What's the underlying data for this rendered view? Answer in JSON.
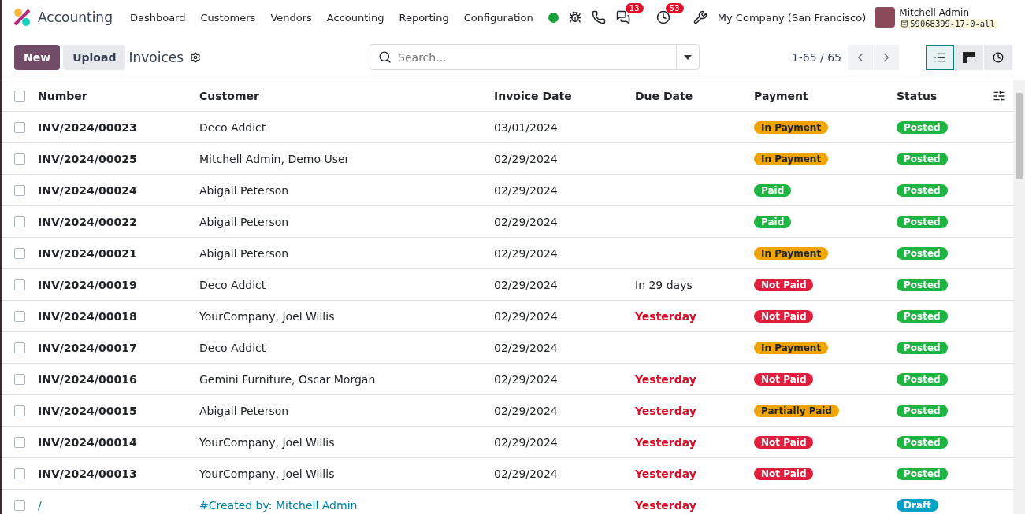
{
  "app": {
    "name": "Accounting"
  },
  "menu": [
    "Dashboard",
    "Customers",
    "Vendors",
    "Accounting",
    "Reporting",
    "Configuration"
  ],
  "systray": {
    "messages_count": "13",
    "activities_count": "53",
    "company": "My Company (San Francisco)",
    "user": "Mitchell Admin",
    "database": "59068399-17-0-all"
  },
  "control": {
    "new": "New",
    "upload": "Upload",
    "title": "Invoices",
    "search_placeholder": "Search...",
    "pager": "1-65 / 65",
    "views": [
      {
        "kind": "list",
        "selected": true
      },
      {
        "kind": "kanban",
        "selected": false
      },
      {
        "kind": "activity",
        "selected": false
      }
    ]
  },
  "table": {
    "all_checked": false,
    "columns": [
      "Number",
      "Customer",
      "Invoice Date",
      "Due Date",
      "Payment",
      "Status"
    ],
    "rows": [
      {
        "number": "INV/2024/00023",
        "customer": "Deco Addict",
        "invoice_date": "03/01/2024",
        "payment": {
          "label": "In Payment",
          "kind": "in_payment"
        },
        "status": {
          "label": "Posted",
          "kind": "posted"
        },
        "checked": false
      },
      {
        "number": "INV/2024/00025",
        "customer": "Mitchell Admin, Demo User",
        "invoice_date": "02/29/2024",
        "payment": {
          "label": "In Payment",
          "kind": "in_payment"
        },
        "status": {
          "label": "Posted",
          "kind": "posted"
        },
        "checked": false
      },
      {
        "number": "INV/2024/00024",
        "customer": "Abigail Peterson",
        "invoice_date": "02/29/2024",
        "payment": {
          "label": "Paid",
          "kind": "paid"
        },
        "status": {
          "label": "Posted",
          "kind": "posted"
        },
        "checked": false
      },
      {
        "number": "INV/2024/00022",
        "customer": "Abigail Peterson",
        "invoice_date": "02/29/2024",
        "payment": {
          "label": "Paid",
          "kind": "paid"
        },
        "status": {
          "label": "Posted",
          "kind": "posted"
        },
        "checked": false
      },
      {
        "number": "INV/2024/00021",
        "customer": "Abigail Peterson",
        "invoice_date": "02/29/2024",
        "payment": {
          "label": "In Payment",
          "kind": "in_payment"
        },
        "status": {
          "label": "Posted",
          "kind": "posted"
        },
        "checked": false
      },
      {
        "number": "INV/2024/00019",
        "customer": "Deco Addict",
        "invoice_date": "02/29/2024",
        "due": {
          "label": "In 29 days",
          "kind": "upcoming"
        },
        "payment": {
          "label": "Not Paid",
          "kind": "not_paid"
        },
        "status": {
          "label": "Posted",
          "kind": "posted"
        },
        "checked": false
      },
      {
        "number": "INV/2024/00018",
        "customer": "YourCompany, Joel Willis",
        "invoice_date": "02/29/2024",
        "due": {
          "label": "Yesterday",
          "kind": "overdue"
        },
        "payment": {
          "label": "Not Paid",
          "kind": "not_paid"
        },
        "status": {
          "label": "Posted",
          "kind": "posted"
        },
        "checked": false
      },
      {
        "number": "INV/2024/00017",
        "customer": "Deco Addict",
        "invoice_date": "02/29/2024",
        "payment": {
          "label": "In Payment",
          "kind": "in_payment"
        },
        "status": {
          "label": "Posted",
          "kind": "posted"
        },
        "checked": false
      },
      {
        "number": "INV/2024/00016",
        "customer": "Gemini Furniture, Oscar Morgan",
        "invoice_date": "02/29/2024",
        "due": {
          "label": "Yesterday",
          "kind": "overdue"
        },
        "payment": {
          "label": "Not Paid",
          "kind": "not_paid"
        },
        "status": {
          "label": "Posted",
          "kind": "posted"
        },
        "checked": false
      },
      {
        "number": "INV/2024/00015",
        "customer": "Abigail Peterson",
        "invoice_date": "02/29/2024",
        "due": {
          "label": "Yesterday",
          "kind": "overdue"
        },
        "payment": {
          "label": "Partially Paid",
          "kind": "partially_paid"
        },
        "status": {
          "label": "Posted",
          "kind": "posted"
        },
        "checked": false
      },
      {
        "number": "INV/2024/00014",
        "customer": "YourCompany, Joel Willis",
        "invoice_date": "02/29/2024",
        "due": {
          "label": "Yesterday",
          "kind": "overdue"
        },
        "payment": {
          "label": "Not Paid",
          "kind": "not_paid"
        },
        "status": {
          "label": "Posted",
          "kind": "posted"
        },
        "checked": false
      },
      {
        "number": "INV/2024/00013",
        "customer": "YourCompany, Joel Willis",
        "invoice_date": "02/29/2024",
        "due": {
          "label": "Yesterday",
          "kind": "overdue"
        },
        "payment": {
          "label": "Not Paid",
          "kind": "not_paid"
        },
        "status": {
          "label": "Posted",
          "kind": "posted"
        },
        "checked": false
      },
      {
        "number": "/",
        "customer": "#Created by: Mitchell Admin",
        "due": {
          "label": "Yesterday",
          "kind": "overdue"
        },
        "status": {
          "label": "Draft",
          "kind": "draft"
        },
        "checked": false
      }
    ]
  }
}
